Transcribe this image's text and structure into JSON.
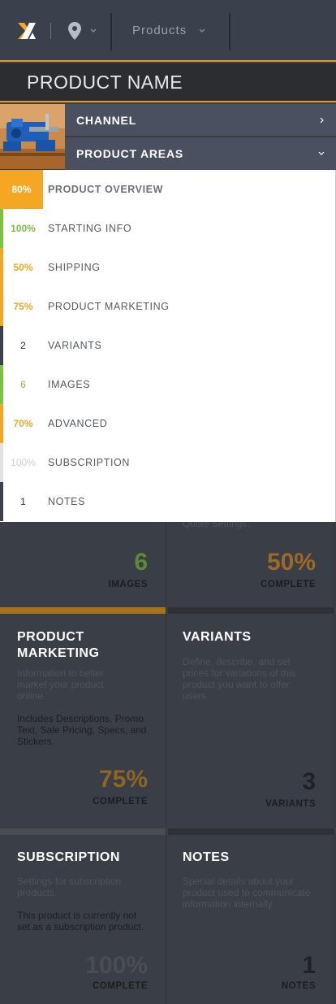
{
  "colors": {
    "accent": "#f5a623",
    "green": "#7cc242",
    "dark_status": "#3c424d",
    "muted": "#cfcfcf",
    "dark_text": "#2a2d33"
  },
  "header": {
    "products_label": "Products",
    "icons": [
      "brand-logo-icon",
      "location-pin-icon",
      "chevron-down-icon"
    ]
  },
  "product": {
    "name": "PRODUCT NAME"
  },
  "dropdown": {
    "channel_label": "CHANNEL",
    "areas_label": "PRODUCT AREAS"
  },
  "menu": {
    "items": [
      {
        "value": "80%",
        "label": "PRODUCT OVERVIEW",
        "status": "orange",
        "active": true
      },
      {
        "value": "100%",
        "label": "STARTING INFO",
        "status": "green"
      },
      {
        "value": "50%",
        "label": "SHIPPING",
        "status": "orange"
      },
      {
        "value": "75%",
        "label": "PRODUCT MARKETING",
        "status": "orange"
      },
      {
        "value": "2",
        "label": "VARIANTS",
        "status": "dark"
      },
      {
        "value": "6",
        "label": "IMAGES",
        "status": "green"
      },
      {
        "value": "70%",
        "label": "ADVANCED",
        "status": "orange"
      },
      {
        "value": "100%",
        "label": "SUBSCRIPTION",
        "status": "muted"
      },
      {
        "value": "1",
        "label": "NOTES",
        "status": "dark"
      }
    ]
  },
  "cards": {
    "top_left": {
      "big": "6",
      "small": "IMAGES"
    },
    "top_right": {
      "partial_text": "Quote Settings.",
      "big": "50%",
      "small": "COMPLETE"
    },
    "product_marketing": {
      "title": "PRODUCT MARKETING",
      "desc": "Information to better market your product online.",
      "note": "Includes Descriptions, Promo Text, Sale Pricing, Specs, and Stickers.",
      "big": "75%",
      "small": "COMPLETE"
    },
    "variants": {
      "title": "VARIANTS",
      "desc": "Define, describe, and set prices for variations of this product you want to offer users",
      "big": "3",
      "small": "VARIANTS"
    },
    "subscription": {
      "title": "SUBSCRIPTION",
      "desc": "Settings for subscription products.",
      "note": "This product is currently not set as a subscription product.",
      "big": "100%",
      "small": "COMPLETE"
    },
    "notes": {
      "title": "NOTES",
      "desc": "Special details about your product used to communicate information internally",
      "big": "1",
      "small": "NOTES"
    }
  }
}
